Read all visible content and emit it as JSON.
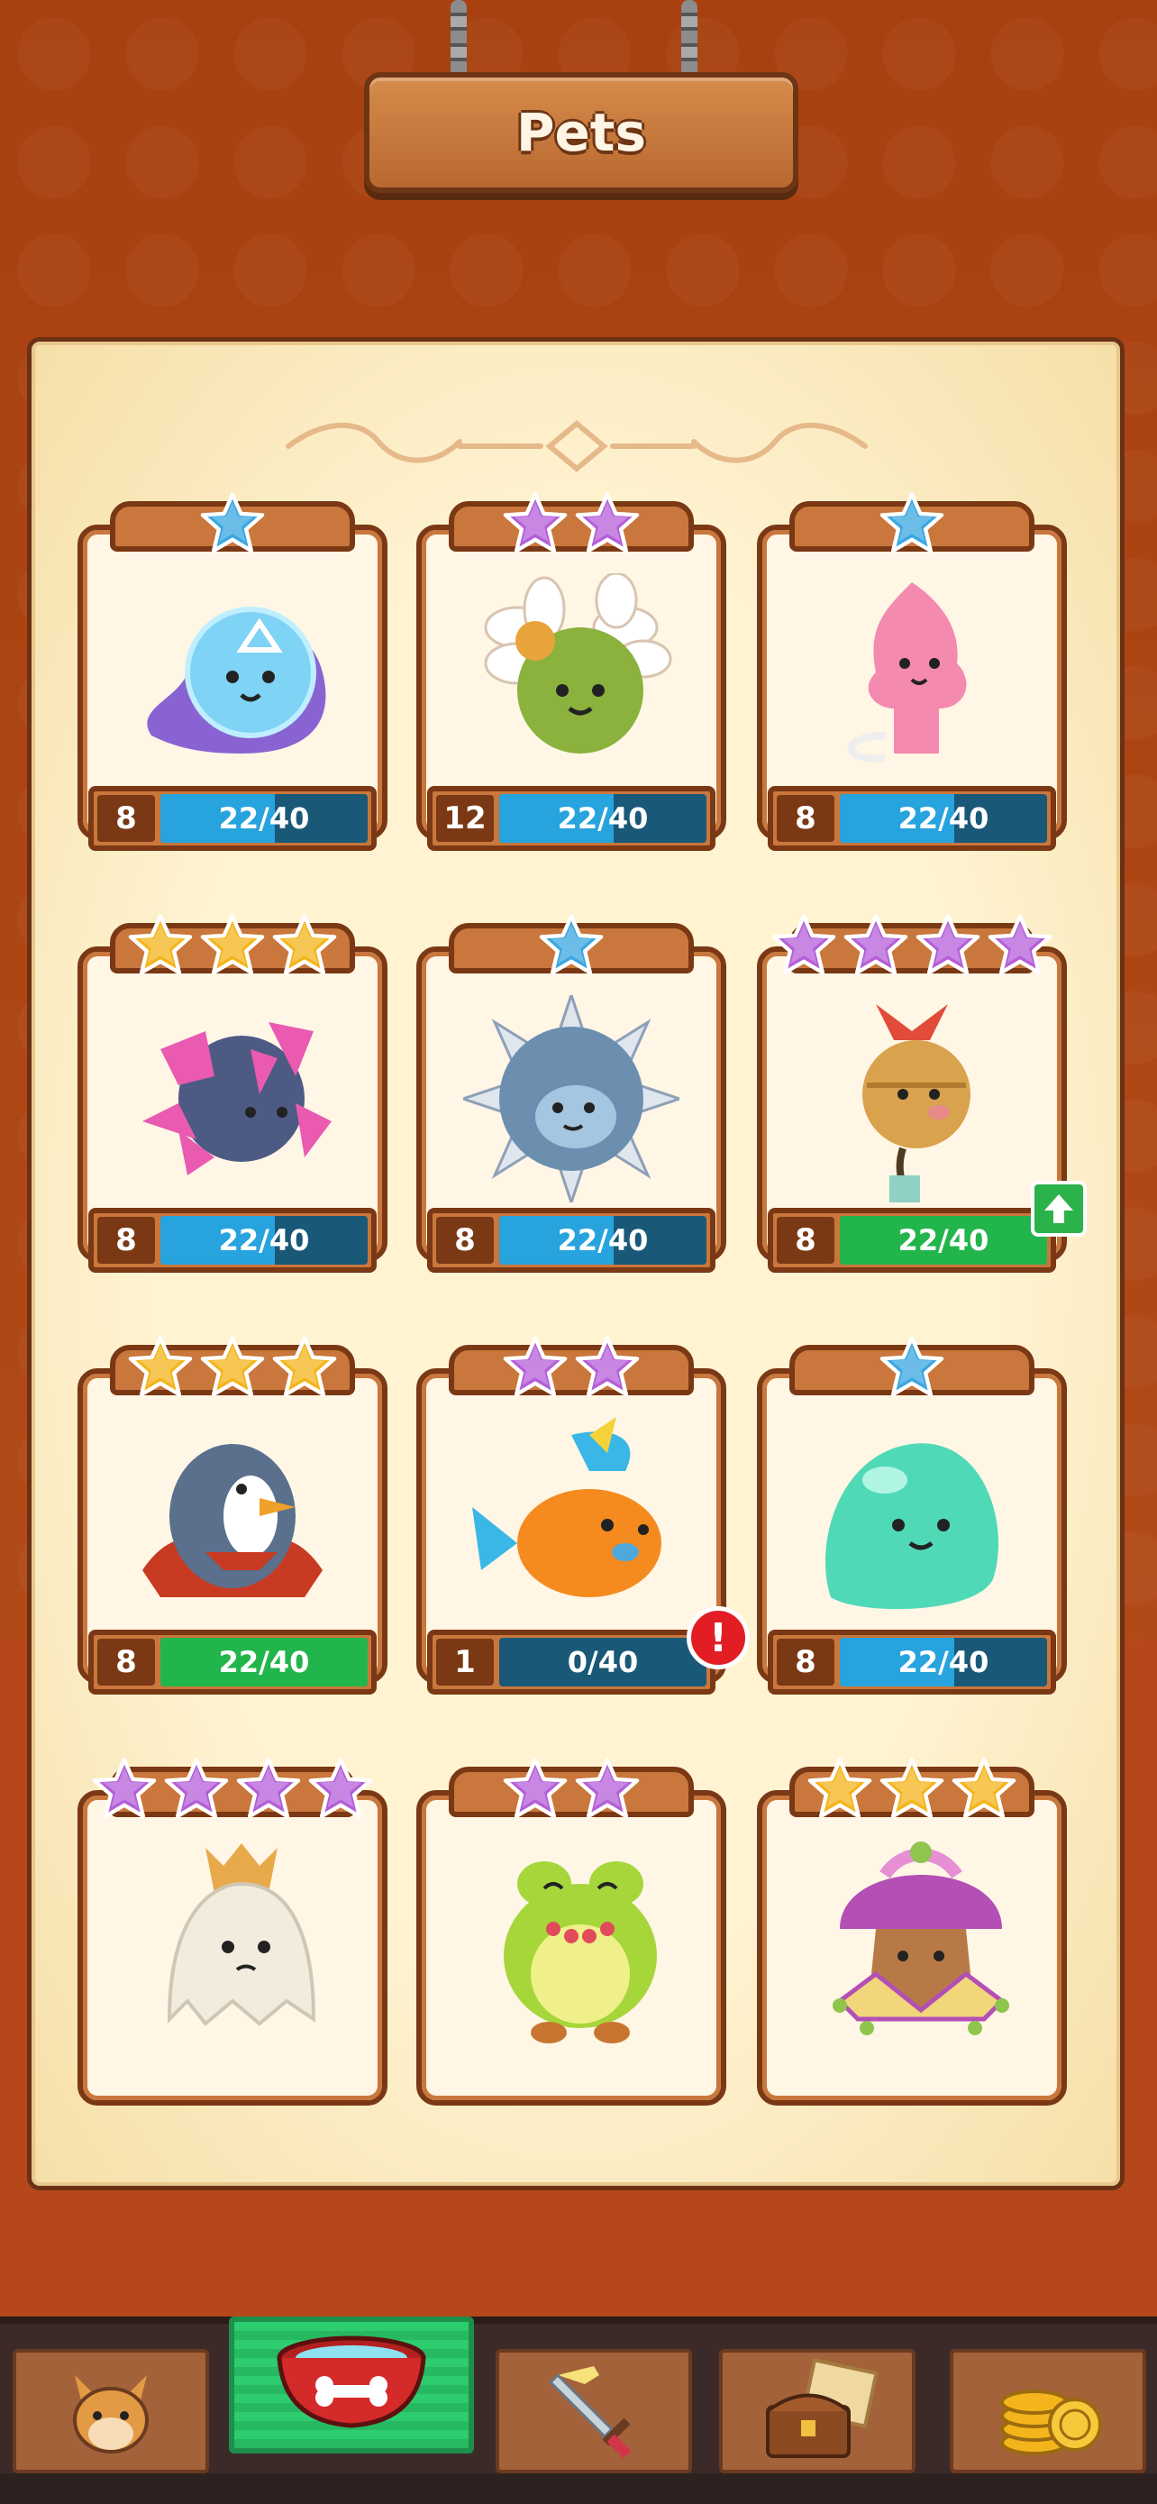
{
  "header": {
    "title": "Pets"
  },
  "colors": {
    "star_blue": "#3aa7e0",
    "star_purple": "#b45fd8",
    "star_gold": "#f4b51c",
    "progress_blue": "#27a3de",
    "progress_green": "#22b54c"
  },
  "pets": [
    {
      "name_icon": "galaxy-blob-pet-icon",
      "stars": 1,
      "star_color": "blue",
      "level": "8",
      "progress_text": "22/40",
      "progress": 0.55,
      "bar_color": "blue"
    },
    {
      "name_icon": "daisy-bud-pet-icon",
      "stars": 2,
      "star_color": "purple",
      "level": "12",
      "progress_text": "22/40",
      "progress": 0.55,
      "bar_color": "blue"
    },
    {
      "name_icon": "pink-sprite-pet-icon",
      "stars": 1,
      "star_color": "blue",
      "level": "8",
      "progress_text": "22/40",
      "progress": 0.55,
      "bar_color": "blue"
    },
    {
      "name_icon": "crystal-ball-pet-icon",
      "stars": 3,
      "star_color": "gold",
      "level": "8",
      "progress_text": "22/40",
      "progress": 0.55,
      "bar_color": "blue"
    },
    {
      "name_icon": "spiky-mine-pet-icon",
      "stars": 1,
      "star_color": "blue",
      "level": "8",
      "progress_text": "22/40",
      "progress": 0.55,
      "bar_color": "blue"
    },
    {
      "name_icon": "bell-balloon-pet-icon",
      "stars": 4,
      "star_color": "purple",
      "level": "8",
      "progress_text": "22/40",
      "progress": 1.0,
      "bar_color": "green",
      "badge": "upgrade"
    },
    {
      "name_icon": "caped-penguin-pet-icon",
      "stars": 3,
      "star_color": "gold",
      "level": "8",
      "progress_text": "22/40",
      "progress": 1.0,
      "bar_color": "green"
    },
    {
      "name_icon": "orange-fish-pet-icon",
      "stars": 2,
      "star_color": "purple",
      "level": "1",
      "progress_text": "0/40",
      "progress": 0.0,
      "bar_color": "blue",
      "badge": "alert"
    },
    {
      "name_icon": "green-slime-pet-icon",
      "stars": 1,
      "star_color": "blue",
      "level": "8",
      "progress_text": "22/40",
      "progress": 0.55,
      "bar_color": "blue"
    },
    {
      "name_icon": "crowned-ghost-pet-icon",
      "stars": 4,
      "star_color": "purple",
      "level": null,
      "progress_text": null,
      "progress": null
    },
    {
      "name_icon": "frog-necklace-pet-icon",
      "stars": 2,
      "star_color": "purple",
      "level": null,
      "progress_text": null,
      "progress": null
    },
    {
      "name_icon": "jester-onion-pet-icon",
      "stars": 3,
      "star_color": "gold",
      "level": null,
      "progress_text": null,
      "progress": null
    }
  ],
  "badges": {
    "alert_text": "!"
  },
  "nav": [
    {
      "icon": "fox-hero-icon",
      "active": false
    },
    {
      "icon": "pet-bowl-icon",
      "active": true
    },
    {
      "icon": "sword-icon",
      "active": false
    },
    {
      "icon": "treasure-chest-map-icon",
      "active": false
    },
    {
      "icon": "gold-coins-icon",
      "active": false
    }
  ]
}
